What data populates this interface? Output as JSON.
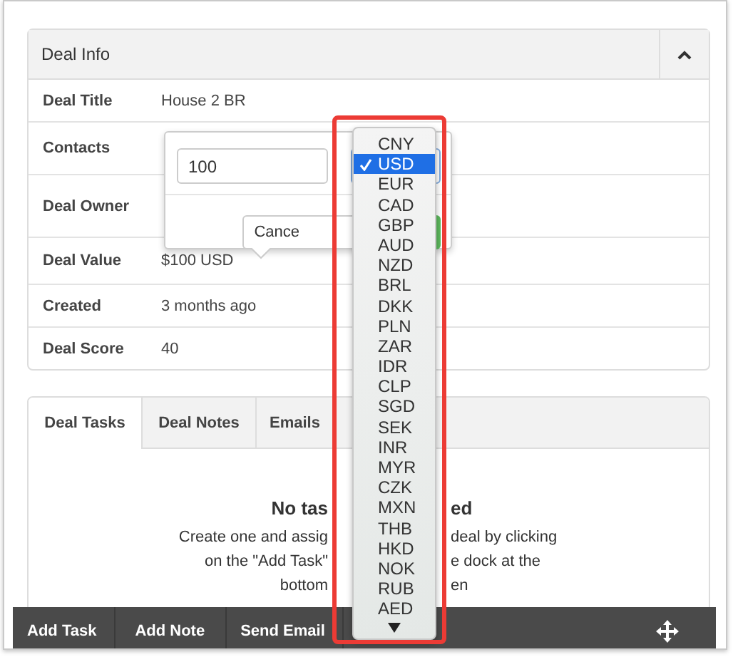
{
  "deal_info": {
    "title": "Deal Info",
    "expanded": true,
    "rows": [
      {
        "label": "Deal Title",
        "value": "House 2 BR"
      },
      {
        "label": "Contacts"
      },
      {
        "label": "Deal Owner"
      },
      {
        "label": "Deal Value",
        "value": "$100 USD"
      },
      {
        "label": "Created",
        "value": "3 months ago"
      },
      {
        "label": "Deal Score",
        "value": "40"
      }
    ]
  },
  "popover": {
    "amount": "100",
    "cancel": "Cance"
  },
  "tabs": [
    {
      "label": "Deal Tasks",
      "selected": true
    },
    {
      "label": "Deal Notes",
      "selected": false
    },
    {
      "label": "Emails",
      "selected": false
    }
  ],
  "empty_state": {
    "heading": [
      "No tas",
      "ed"
    ],
    "lines": [
      [
        "Create one and assig",
        "deal by clicking"
      ],
      [
        "on the \"Add Task\"",
        "e dock at the"
      ],
      [
        "bottom",
        "en"
      ]
    ]
  },
  "dock": {
    "items": [
      "Add Task",
      "Add Note",
      "Send Email"
    ]
  },
  "currency_menu": {
    "items": [
      {
        "label": "CNY",
        "selected": false
      },
      {
        "label": "USD",
        "selected": true
      },
      {
        "label": "EUR",
        "selected": false
      },
      {
        "label": "CAD",
        "selected": false
      },
      {
        "label": "GBP",
        "selected": false
      },
      {
        "label": "AUD",
        "selected": false
      },
      {
        "label": "NZD",
        "selected": false
      },
      {
        "label": "BRL",
        "selected": false
      },
      {
        "label": "DKK",
        "selected": false
      },
      {
        "label": "PLN",
        "selected": false
      },
      {
        "label": "ZAR",
        "selected": false
      },
      {
        "label": "IDR",
        "selected": false
      },
      {
        "label": "CLP",
        "selected": false
      },
      {
        "label": "SGD",
        "selected": false
      },
      {
        "label": "SEK",
        "selected": false
      },
      {
        "label": "INR",
        "selected": false
      },
      {
        "label": "MYR",
        "selected": false
      },
      {
        "label": "CZK",
        "selected": false
      },
      {
        "label": "MXN",
        "selected": false
      },
      {
        "label": "THB",
        "selected": false
      },
      {
        "label": "HKD",
        "selected": false
      },
      {
        "label": "NOK",
        "selected": false
      },
      {
        "label": "RUB",
        "selected": false
      },
      {
        "label": "AED",
        "selected": false
      }
    ]
  }
}
